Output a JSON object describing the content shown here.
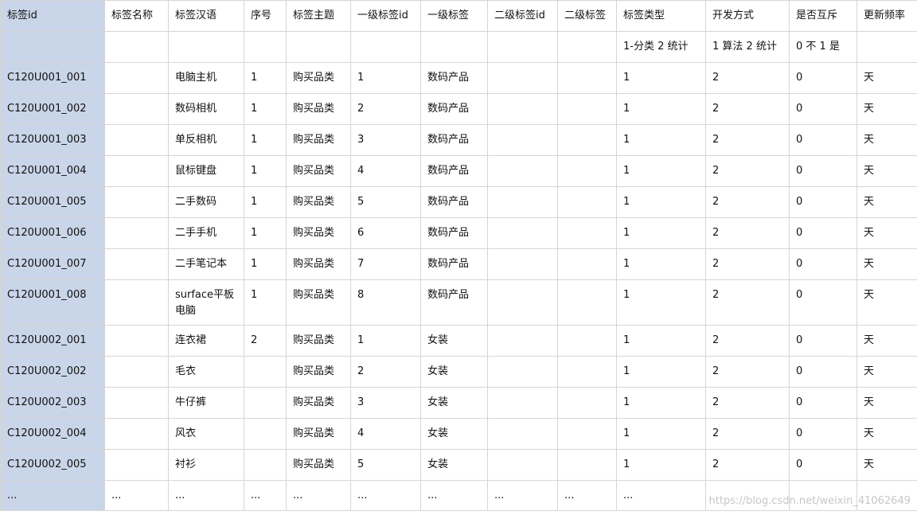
{
  "headers": [
    "标签id",
    "标签名称",
    "标签汉语",
    "序号",
    "标签主题",
    "一级标签id",
    "一级标签",
    "二级标签id",
    "二级标签",
    "标签类型",
    "开发方式",
    "是否互斥",
    "更新频率"
  ],
  "legend": [
    "",
    "",
    "",
    "",
    "",
    "",
    "",
    "",
    "",
    "1-分类 2 统计",
    "1 算法 2 统计",
    "0 不 1 是",
    ""
  ],
  "rows": [
    [
      "C120U001_001",
      "",
      "电脑主机",
      "1",
      "购买品类",
      "1",
      "数码产品",
      "",
      "",
      "1",
      "2",
      "0",
      "天"
    ],
    [
      "C120U001_002",
      "",
      "数码相机",
      "1",
      "购买品类",
      "2",
      "数码产品",
      "",
      "",
      "1",
      "2",
      "0",
      "天"
    ],
    [
      "C120U001_003",
      "",
      "单反相机",
      "1",
      "购买品类",
      "3",
      "数码产品",
      "",
      "",
      "1",
      "2",
      "0",
      "天"
    ],
    [
      "C120U001_004",
      "",
      "鼠标键盘",
      "1",
      "购买品类",
      "4",
      "数码产品",
      "",
      "",
      "1",
      "2",
      "0",
      "天"
    ],
    [
      "C120U001_005",
      "",
      "二手数码",
      "1",
      "购买品类",
      "5",
      "数码产品",
      "",
      "",
      "1",
      "2",
      "0",
      "天"
    ],
    [
      "C120U001_006",
      "",
      "二手手机",
      "1",
      "购买品类",
      "6",
      "数码产品",
      "",
      "",
      "1",
      "2",
      "0",
      "天"
    ],
    [
      "C120U001_007",
      "",
      "二手笔记本",
      "1",
      "购买品类",
      "7",
      "数码产品",
      "",
      "",
      "1",
      "2",
      "0",
      "天"
    ],
    [
      "C120U001_008",
      "",
      "surface平板电脑",
      "1",
      "购买品类",
      "8",
      "数码产品",
      "",
      "",
      "1",
      "2",
      "0",
      "天"
    ],
    [
      "C120U002_001",
      "",
      "连衣裙",
      "2",
      "购买品类",
      "1",
      "女装",
      "",
      "",
      "1",
      "2",
      "0",
      "天"
    ],
    [
      "C120U002_002",
      "",
      "毛衣",
      "",
      "购买品类",
      "2",
      "女装",
      "",
      "",
      "1",
      "2",
      "0",
      "天"
    ],
    [
      "C120U002_003",
      "",
      "牛仔裤",
      "",
      "购买品类",
      "3",
      "女装",
      "",
      "",
      "1",
      "2",
      "0",
      "天"
    ],
    [
      "C120U002_004",
      "",
      "风衣",
      "",
      "购买品类",
      "4",
      "女装",
      "",
      "",
      "1",
      "2",
      "0",
      "天"
    ],
    [
      "C120U002_005",
      "",
      "衬衫",
      "",
      "购买品类",
      "5",
      "女装",
      "",
      "",
      "1",
      "2",
      "0",
      "天"
    ],
    [
      "...",
      "...",
      "...",
      "...",
      "...",
      "...",
      "...",
      "...",
      "...",
      "...",
      "",
      "",
      ""
    ]
  ],
  "watermark": "https://blog.csdn.net/weixin_41062649"
}
